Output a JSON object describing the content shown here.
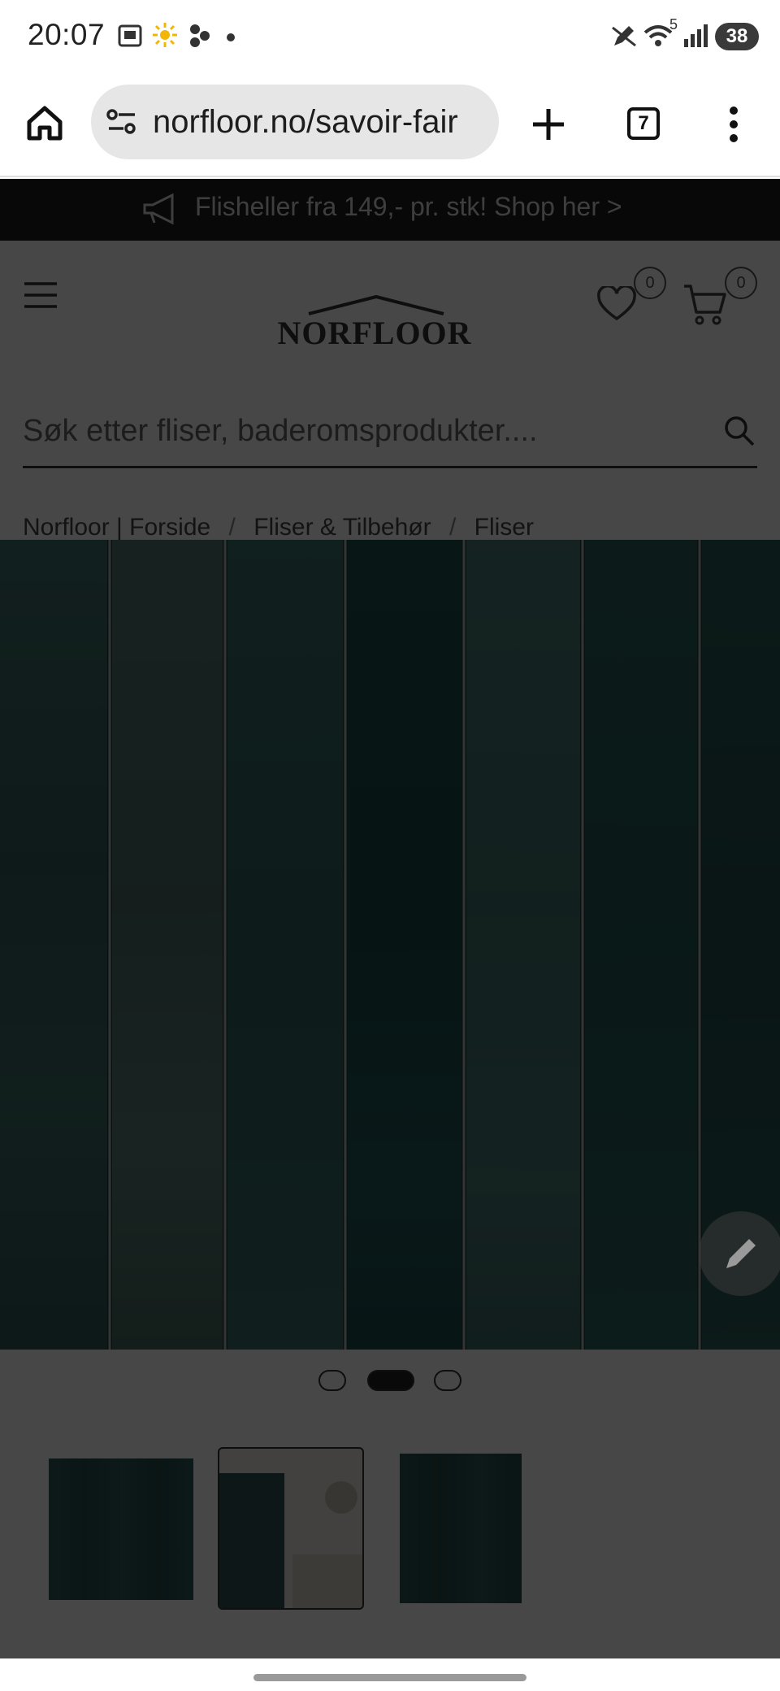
{
  "status_bar": {
    "time": "20:07",
    "battery": "38",
    "network_label": "5"
  },
  "browser": {
    "url": "norfloor.no/savoir-fair",
    "tab_count": "7"
  },
  "page": {
    "promo_text": "Flisheller fra 149,- pr. stk! Shop her >",
    "logo_text": "NORFLOOR",
    "wishlist_count": "0",
    "cart_count": "0",
    "search_placeholder": "Søk etter fliser, baderomsprodukter....",
    "breadcrumb": [
      "Norfloor | Forside",
      "Fliser & Tilbehør",
      "Fliser"
    ],
    "breadcrumb_separator": "/",
    "carousel": {
      "slides": 3,
      "active_index": 1
    },
    "thumbnails_active_index": 1
  },
  "colors": {
    "tile_teal": "#3b6d69",
    "promo_bg": "#1e1e1e",
    "overlay": "rgba(0,0,0,0.72)"
  },
  "icons": [
    "home-icon",
    "site-info-icon",
    "new-tab-icon",
    "more-icon",
    "hamburger-menu-icon",
    "heart-icon",
    "cart-icon",
    "search-icon",
    "pencil-icon",
    "megaphone-icon"
  ]
}
